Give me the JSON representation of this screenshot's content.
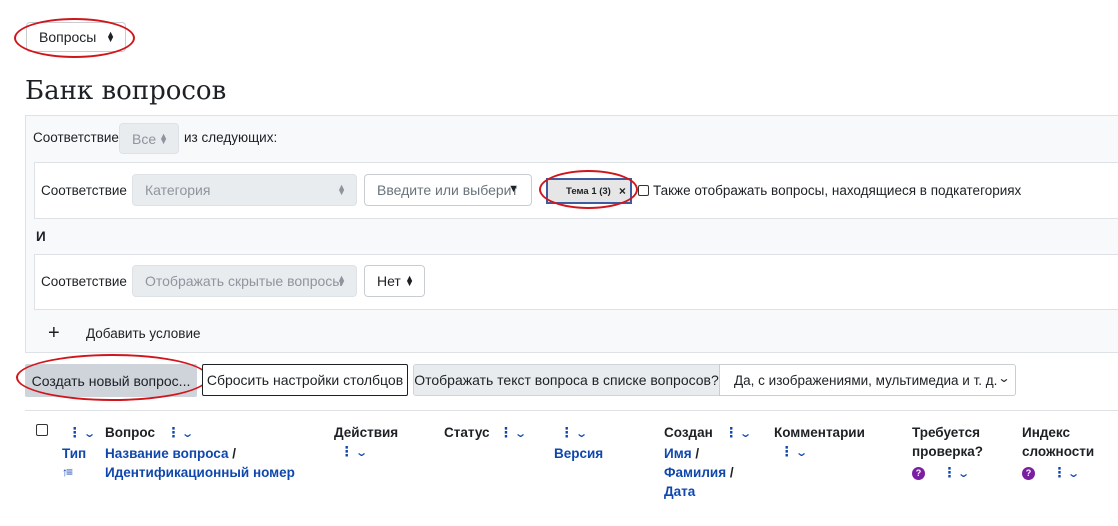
{
  "nav_select": {
    "value": "Вопросы"
  },
  "page_title": "Банк вопросов",
  "filter": {
    "match_label": "Соответствие",
    "match_value": "Все",
    "match_suffix": "из следующих:",
    "conditions": [
      {
        "match_label": "Соответствие",
        "type_value": "Категория",
        "search_placeholder": "Введите или выберите",
        "chip_label": "Тема 1 (3)",
        "chip_remove": "×",
        "subcat_label": "Также отображать вопросы, находящиеся в подкатегориях"
      },
      {
        "match_label": "Соответствие",
        "type_value": "Отображать скрытые вопросы",
        "value": "Нет"
      }
    ],
    "and_label": "И",
    "add_icon": "+",
    "add_label": "Добавить условие"
  },
  "toolbar": {
    "create_label": "Создать новый вопрос...",
    "reset_label": "Сбросить настройки столбцов",
    "show_text_label": "Отображать текст вопроса в списке вопросов?",
    "show_text_value": "Да, с изображениями, мультимедиа и т. д."
  },
  "table": {
    "headers": {
      "type": "Тип",
      "question": "Вопрос",
      "question_name": "Название вопроса",
      "question_sep": "/",
      "question_id": "Идентификационный номер",
      "actions": "Действия",
      "status": "Статус",
      "version": "Версия",
      "created": "Создан",
      "first_name": "Имя",
      "last_name": "Фамилия",
      "date": "Дата",
      "comments": "Комментарии",
      "needs_review_1": "Требуется",
      "needs_review_2": "проверка?",
      "difficulty_1": "Индекс",
      "difficulty_2": "сложности"
    }
  },
  "icons": {
    "kebab": "⋮",
    "chevron": "⌄",
    "sort": "↑≡",
    "help": "?"
  },
  "colors": {
    "annotation_red": "#d0161b",
    "link_blue": "#0f47ad",
    "help_purple": "#7b1fa2"
  }
}
